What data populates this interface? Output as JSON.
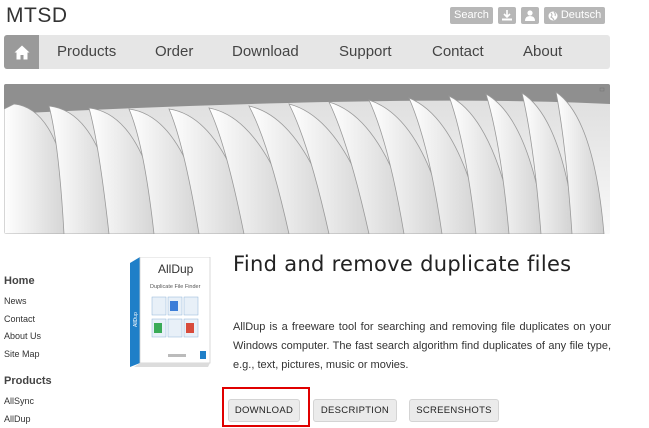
{
  "header": {
    "logo": "MTSD"
  },
  "top_actions": {
    "search_label": "Search",
    "language_label": "Deutsch"
  },
  "nav": {
    "items": [
      "Products",
      "Order",
      "Download",
      "Support",
      "Contact",
      "About"
    ]
  },
  "sidebar": {
    "home_heading": "Home",
    "home_links": [
      "News",
      "Contact",
      "About Us",
      "Site Map"
    ],
    "products_heading": "Products",
    "product_links": [
      "AllSync",
      "AllDup"
    ]
  },
  "product_box": {
    "brand": "AllDup",
    "subtitle": "Duplicate File Finder",
    "side_text": "AllDup"
  },
  "main": {
    "title": "Find and remove duplicate files",
    "description": "AllDup is a freeware tool for searching and removing file duplicates on your Windows computer. The fast search algorithm find duplicates of any file type, e.g., text, pictures, music or movies.",
    "buttons": [
      "DOWNLOAD",
      "DESCRIPTION",
      "SCREENSHOTS"
    ]
  },
  "colors": {
    "nav_bg": "#e6e6e6",
    "home_bg": "#9a9a9a",
    "top_button_bg": "#b7b7b7",
    "highlight": "#e00000"
  }
}
